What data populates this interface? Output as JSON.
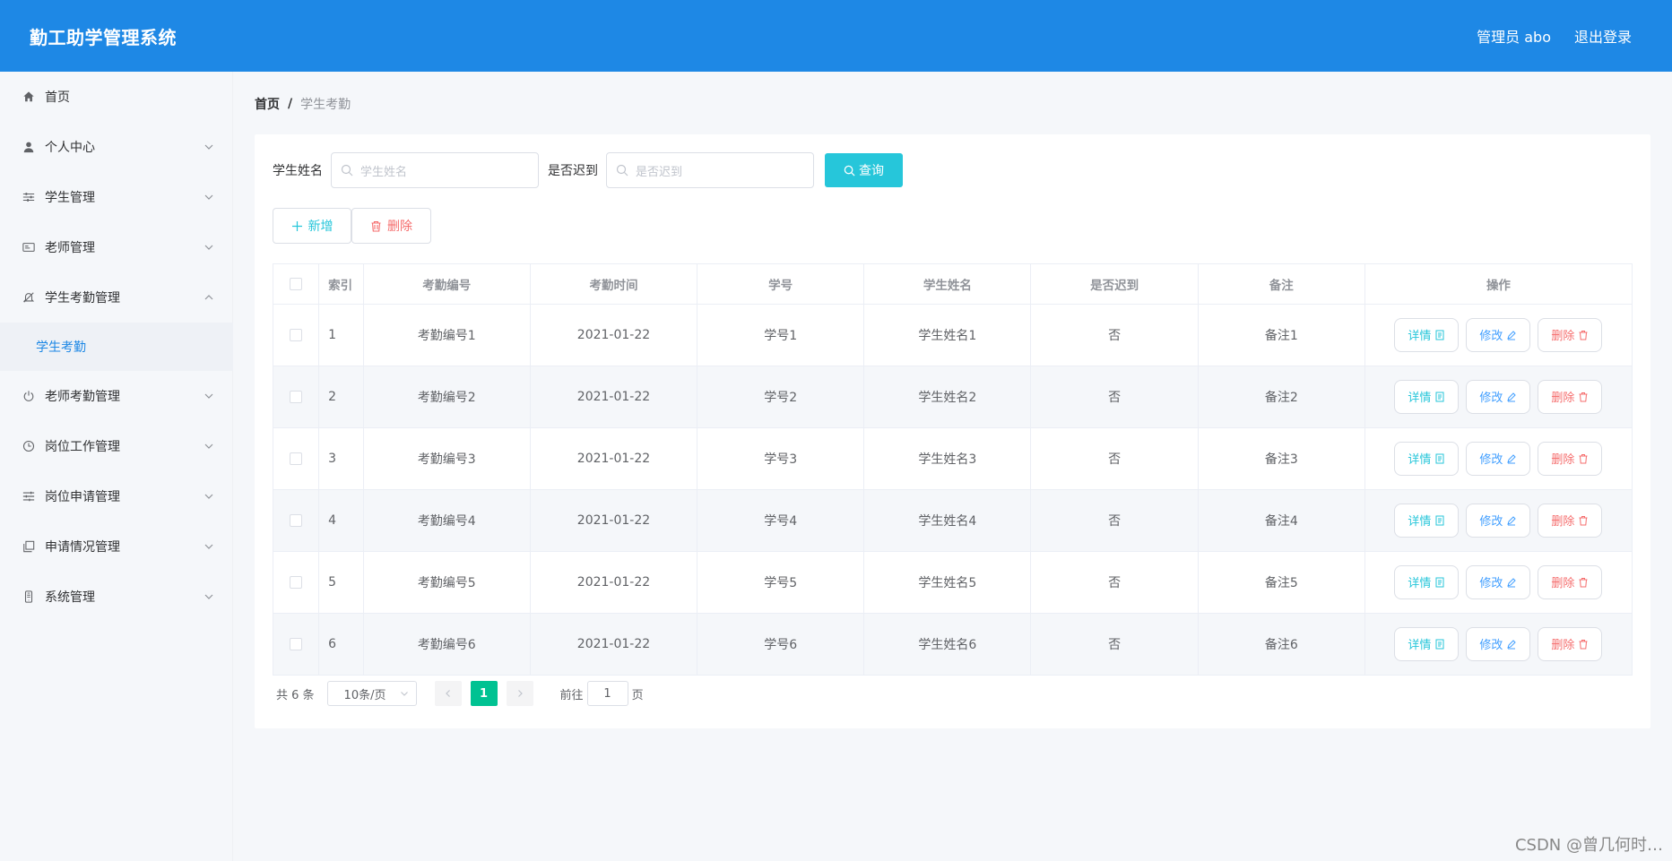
{
  "header": {
    "title": "勤工助学管理系统",
    "user": "管理员 abo",
    "logout": "退出登录"
  },
  "sidebar": {
    "items": [
      {
        "label": "首页",
        "icon": "home-icon",
        "expandable": false
      },
      {
        "label": "个人中心",
        "icon": "user-icon",
        "expandable": true
      },
      {
        "label": "学生管理",
        "icon": "sliders-icon",
        "expandable": true
      },
      {
        "label": "老师管理",
        "icon": "id-card-icon",
        "expandable": true
      },
      {
        "label": "学生考勤管理",
        "icon": "bell-off-icon",
        "expandable": true,
        "expanded": true
      },
      {
        "label": "老师考勤管理",
        "icon": "power-icon",
        "expandable": true
      },
      {
        "label": "岗位工作管理",
        "icon": "clock-icon",
        "expandable": true
      },
      {
        "label": "岗位申请管理",
        "icon": "list-icon",
        "expandable": true
      },
      {
        "label": "申请情况管理",
        "icon": "copy-icon",
        "expandable": true
      },
      {
        "label": "系统管理",
        "icon": "phone-icon",
        "expandable": true
      }
    ],
    "submenu": {
      "label": "学生考勤"
    }
  },
  "breadcrumb": {
    "home": "首页",
    "sep": "/",
    "current": "学生考勤"
  },
  "search": {
    "name_label": "学生姓名",
    "name_placeholder": "学生姓名",
    "late_label": "是否迟到",
    "late_placeholder": "是否迟到",
    "query_button": "查询"
  },
  "actions": {
    "add": "新增",
    "delete": "删除"
  },
  "table": {
    "headers": [
      "索引",
      "考勤编号",
      "考勤时间",
      "学号",
      "学生姓名",
      "是否迟到",
      "备注",
      "操作"
    ],
    "rows": [
      {
        "index": "1",
        "code": "考勤编号1",
        "time": "2021-01-22",
        "sid": "学号1",
        "name": "学生姓名1",
        "late": "否",
        "note": "备注1"
      },
      {
        "index": "2",
        "code": "考勤编号2",
        "time": "2021-01-22",
        "sid": "学号2",
        "name": "学生姓名2",
        "late": "否",
        "note": "备注2"
      },
      {
        "index": "3",
        "code": "考勤编号3",
        "time": "2021-01-22",
        "sid": "学号3",
        "name": "学生姓名3",
        "late": "否",
        "note": "备注3"
      },
      {
        "index": "4",
        "code": "考勤编号4",
        "time": "2021-01-22",
        "sid": "学号4",
        "name": "学生姓名4",
        "late": "否",
        "note": "备注4"
      },
      {
        "index": "5",
        "code": "考勤编号5",
        "time": "2021-01-22",
        "sid": "学号5",
        "name": "学生姓名5",
        "late": "否",
        "note": "备注5"
      },
      {
        "index": "6",
        "code": "考勤编号6",
        "time": "2021-01-22",
        "sid": "学号6",
        "name": "学生姓名6",
        "late": "否",
        "note": "备注6"
      }
    ],
    "op_labels": {
      "detail": "详情",
      "edit": "修改",
      "delete": "删除"
    }
  },
  "pagination": {
    "total": "共 6 条",
    "page_size": "10条/页",
    "current_page": "1",
    "goto_label": "前往",
    "goto_value": "1",
    "page_suffix": "页"
  },
  "watermark": "CSDN @曾几何时…",
  "colors": {
    "header_bg": "#1e88e5",
    "query_btn": "#26c6da",
    "active_page": "#00c292",
    "danger": "#f56c6c",
    "edit": "#409eff"
  }
}
